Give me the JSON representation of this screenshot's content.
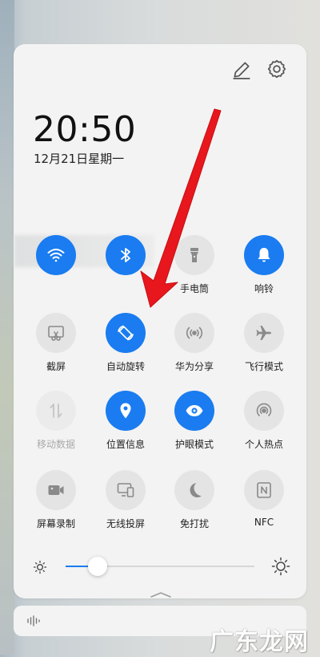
{
  "header": {
    "edit_icon": "pencil-icon",
    "settings_icon": "gear-icon"
  },
  "clock": {
    "time": "20:50",
    "date": "12月21日星期一"
  },
  "tiles": [
    {
      "id": "wifi",
      "label": "",
      "icon": "wifi-icon",
      "state": "on"
    },
    {
      "id": "bluetooth",
      "label": "",
      "icon": "bluetooth-icon",
      "state": "on"
    },
    {
      "id": "flashlight",
      "label": "手电筒",
      "icon": "flashlight-icon",
      "state": "off"
    },
    {
      "id": "ring",
      "label": "响铃",
      "icon": "bell-icon",
      "state": "on"
    },
    {
      "id": "screenshot",
      "label": "截屏",
      "icon": "screenshot-icon",
      "state": "off"
    },
    {
      "id": "auto-rotate",
      "label": "自动旋转",
      "icon": "rotate-icon",
      "state": "on"
    },
    {
      "id": "huawei-share",
      "label": "华为分享",
      "icon": "share-icon",
      "state": "off"
    },
    {
      "id": "airplane",
      "label": "飞行模式",
      "icon": "airplane-icon",
      "state": "off"
    },
    {
      "id": "mobile-data",
      "label": "移动数据",
      "icon": "data-arrows-icon",
      "state": "disabled"
    },
    {
      "id": "location",
      "label": "位置信息",
      "icon": "location-pin-icon",
      "state": "on"
    },
    {
      "id": "eye-comfort",
      "label": "护眼模式",
      "icon": "eye-icon",
      "state": "on"
    },
    {
      "id": "hotspot",
      "label": "个人热点",
      "icon": "hotspot-icon",
      "state": "off"
    },
    {
      "id": "screen-record",
      "label": "屏幕录制",
      "icon": "video-camera-icon",
      "state": "off"
    },
    {
      "id": "wireless-projection",
      "label": "无线投屏",
      "icon": "cast-screen-icon",
      "state": "off"
    },
    {
      "id": "do-not-disturb",
      "label": "免打扰",
      "icon": "moon-icon",
      "state": "off"
    },
    {
      "id": "nfc",
      "label": "NFC",
      "icon": "nfc-icon",
      "state": "off"
    }
  ],
  "brightness": {
    "level_percent": 17,
    "low_icon": "sun-small-icon",
    "high_icon": "sun-large-icon"
  },
  "colors": {
    "accent": "#1a7cf0",
    "tile_off": "#e4e4e4",
    "arrow": "#e8171d"
  },
  "watermark": {
    "text": "广东龙网"
  }
}
